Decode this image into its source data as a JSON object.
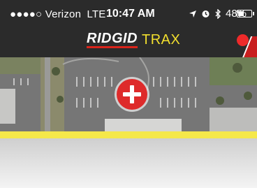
{
  "status_bar": {
    "signal_dots": "●●●●○",
    "carrier": "Verizon",
    "network": "LTE",
    "time": "10:47 AM",
    "battery_text": "48%",
    "battery_level": 0.48,
    "icons": [
      "location-arrow-icon",
      "alarm-icon",
      "bluetooth-icon",
      "battery-icon"
    ]
  },
  "header": {
    "brand": "RIDGID",
    "product": "TRAX",
    "brand_color": "#ffffff",
    "product_color": "#f2df2e",
    "accent_color": "#d9241b"
  },
  "map": {
    "add_button_icon": "plus-icon",
    "add_button_color": "#de2b2b"
  },
  "colors": {
    "top_bar": "#2b2b2b",
    "highlight_band": "#f5e84a",
    "alert": "#ef2a2a"
  }
}
